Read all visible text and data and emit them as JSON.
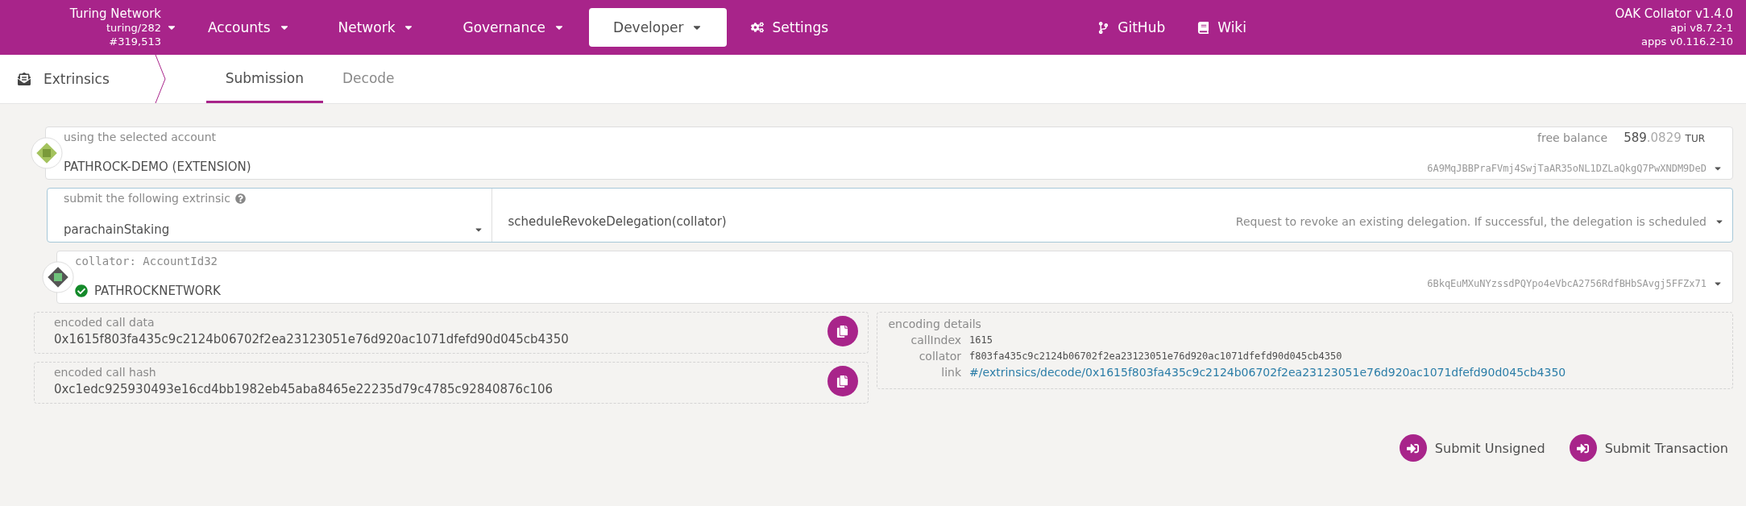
{
  "chain": {
    "name": "Turing Network",
    "spec": "turing/282",
    "block": "#319,513"
  },
  "menu": [
    {
      "label": "Accounts",
      "kind": "dropdown",
      "selected": false
    },
    {
      "label": "Network",
      "kind": "dropdown",
      "selected": false
    },
    {
      "label": "Governance",
      "kind": "dropdown",
      "selected": false
    },
    {
      "label": "Developer",
      "kind": "dropdown",
      "selected": true
    },
    {
      "label": "Settings",
      "kind": "settings",
      "selected": false
    }
  ],
  "links": [
    {
      "label": "GitHub",
      "kind": "github"
    },
    {
      "label": "Wiki",
      "kind": "wiki"
    }
  ],
  "versions": [
    "OAK Collator v1.4.0",
    "api v8.7.2-1",
    "apps v0.116.2-10"
  ],
  "section": {
    "title": "Extrinsics",
    "tabs": [
      {
        "label": "Submission",
        "selected": true
      },
      {
        "label": "Decode",
        "selected": false
      }
    ]
  },
  "account": {
    "label": "using the selected account",
    "name": "PATHROCK-DEMO (EXTENSION)",
    "balance_label": "free balance",
    "balance_whole": "589",
    "balance_fraction": ".0829",
    "balance_unit": "TUR",
    "address": "6A9MqJBBPraFVmj4SwjTaAR35oNL1DZLaQkgQ7PwXNDM9DeD"
  },
  "extrinsic": {
    "label": "submit the following extrinsic",
    "section": "parachainStaking",
    "method": "scheduleRevokeDelegation(collator)",
    "description": "Request to revoke an existing delegation. If successful, the delegation is scheduled"
  },
  "param": {
    "label": "collator: AccountId32",
    "name": "PATHROCKNETWORK",
    "address": "6BkqEuMXuNYzssdPQYpo4eVbcA2756RdfBHbSAvgj5FFZx71",
    "verified": true
  },
  "encoded": [
    {
      "label": "encoded call data",
      "value": "0x1615f803fa435c9c2124b06702f2ea23123051e76d920ac1071dfefd90d045cb4350"
    },
    {
      "label": "encoded call hash",
      "value": "0xc1edc925930493e16cd4bb1982eb45aba8465e22235d79c4785c92840876c106"
    }
  ],
  "details": {
    "title": "encoding details",
    "rows": [
      {
        "key": "callIndex",
        "value": "1615",
        "kind": "mono"
      },
      {
        "key": "collator",
        "value": "f803fa435c9c2124b06702f2ea23123051e76d920ac1071dfefd90d045cb4350",
        "kind": "mono"
      },
      {
        "key": "link",
        "value": "#/extrinsics/decode/0x1615f803fa435c9c2124b06702f2ea23123051e76d920ac1071dfefd90d045cb4350",
        "kind": "link"
      }
    ]
  },
  "actions": [
    "Submit Unsigned",
    "Submit Transaction"
  ]
}
